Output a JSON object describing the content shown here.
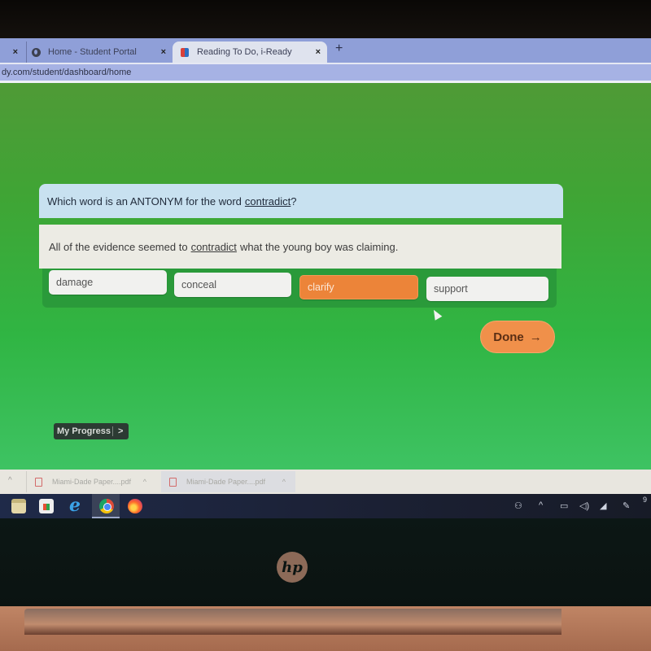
{
  "browser": {
    "tabs": [
      {
        "label": "",
        "close": "×",
        "partial": true
      },
      {
        "label": "Home - Student Portal",
        "close": "×",
        "icon": "globe-icon"
      },
      {
        "label": "Reading To Do, i-Ready",
        "close": "×",
        "icon": "iready-icon",
        "active": true
      }
    ],
    "new_tab": "+",
    "url": "dy.com/student/dashboard/home"
  },
  "lesson": {
    "question_prefix": "Which word is an ANTONYM for the word",
    "question_word": "contradict",
    "question_suffix": "?",
    "passage_prefix": "All of the evidence seemed to",
    "passage_word": "contradict",
    "passage_suffix": "what the young boy was claiming.",
    "answers": [
      {
        "label": "damage",
        "selected": false
      },
      {
        "label": "conceal",
        "selected": false
      },
      {
        "label": "clarify",
        "selected": true
      },
      {
        "label": "support",
        "selected": false
      }
    ],
    "done_label": "Done",
    "done_arrow": "→",
    "progress_label": "My Progress",
    "progress_chevron": ">"
  },
  "downloads": {
    "items": [
      {
        "name": "Miami-Dade Paper....pdf",
        "caret": "^"
      },
      {
        "name": "Miami-Dade Paper....pdf",
        "caret": "^"
      }
    ],
    "left_caret": "^"
  },
  "taskbar": {
    "apps": [
      "file-explorer",
      "microsoft-store",
      "internet-explorer",
      "chrome",
      "firefox"
    ],
    "tray": [
      "people-icon",
      "show-hidden-icon",
      "battery-icon",
      "volume-icon",
      "wifi-icon",
      "pen-icon"
    ],
    "clock_partial": "9"
  },
  "device": {
    "logo": "hp"
  },
  "colors": {
    "page_green": "#30b543",
    "selected_answer": "#ec8439",
    "done_button": "#f0904a",
    "question_bg": "#c8e1f0"
  }
}
